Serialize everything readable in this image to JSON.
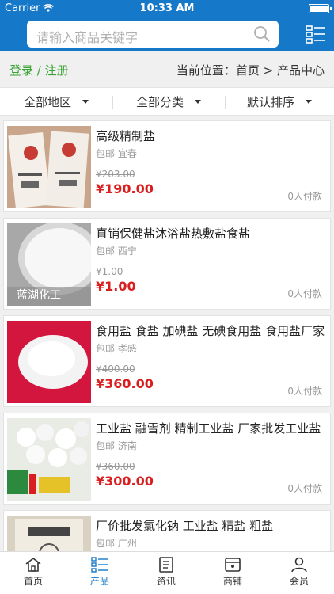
{
  "status": {
    "carrier": "Carrier",
    "time": "10:33 AM"
  },
  "search": {
    "placeholder": "请输入商品关键字"
  },
  "nav": {
    "login": "登录 / 注册",
    "location": "当前位置：首页 > 产品中心"
  },
  "filters": [
    {
      "label": "全部地区"
    },
    {
      "label": "全部分类"
    },
    {
      "label": "默认排序"
    }
  ],
  "products": [
    {
      "title": "高级精制盐",
      "ship": "包邮  宜春",
      "old_price": "¥203.00",
      "price": "¥190.00",
      "paid": "0人付款"
    },
    {
      "title": "直销保健盐沐浴盐热敷盐食盐",
      "ship": "包邮  西宁",
      "old_price": "¥1.00",
      "price": "¥1.00",
      "paid": "0人付款",
      "thumb_text": "蓝湖化工"
    },
    {
      "title": "食用盐 食盐 加碘盐 无碘食用盐 食用盐厂家",
      "ship": "包邮  孝感",
      "old_price": "¥400.00",
      "price": "¥360.00",
      "paid": "0人付款"
    },
    {
      "title": "工业盐 融雪剂 精制工业盐 厂家批发工业盐",
      "ship": "包邮  济南",
      "old_price": "¥360.00",
      "price": "¥300.00",
      "paid": "0人付款"
    },
    {
      "title": "厂价批发氯化钠 工业盐 精盐 粗盐",
      "ship": "包邮  广州"
    }
  ],
  "tabs": [
    {
      "label": "首页"
    },
    {
      "label": "产品"
    },
    {
      "label": "资讯"
    },
    {
      "label": "商铺"
    },
    {
      "label": "会员"
    }
  ],
  "colors": {
    "brand": "#1678c8",
    "price": "#d81e1e",
    "login": "#3aa535"
  }
}
